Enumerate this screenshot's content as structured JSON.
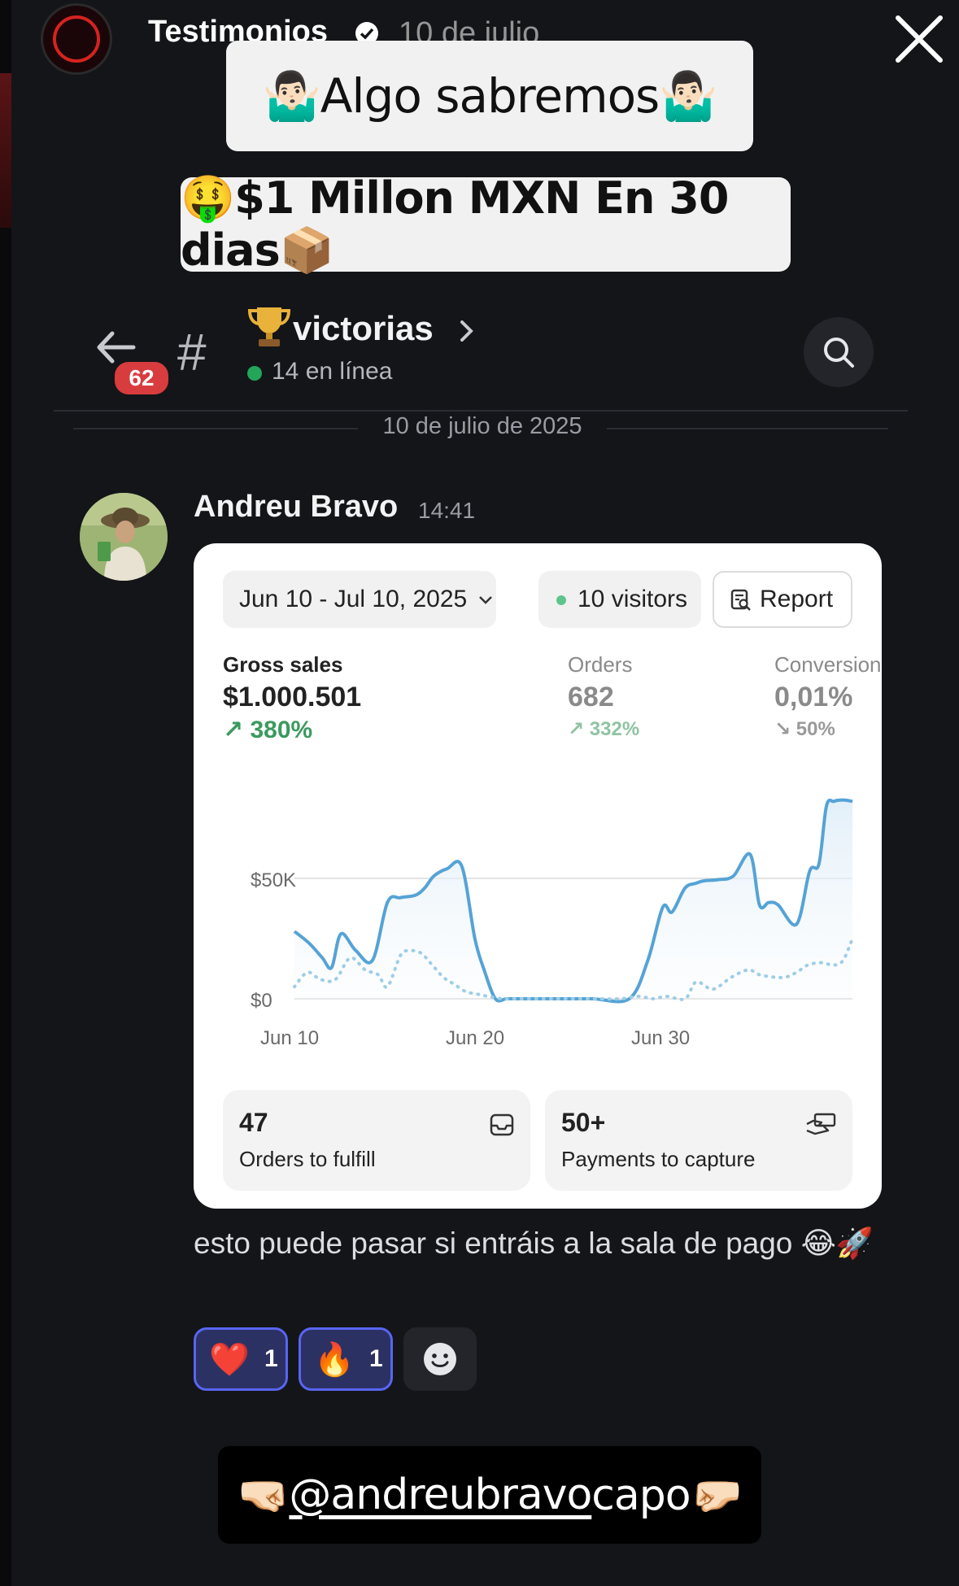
{
  "story": {
    "account": "Testimonios",
    "date": "10 de julio",
    "caption_top": "🤷🏻‍♂️Algo sabremos🤷🏻‍♂️",
    "caption_mid": "🤑$1 Millon MXN En 30 dias📦",
    "caption_bottom_prefix": "🤜🏻",
    "caption_bottom_mention": "@andreubravo",
    "caption_bottom_suffix": " capo🤛🏻"
  },
  "channel": {
    "unread_badge": "62",
    "hash": "#",
    "name": "victorias",
    "online": "14 en línea",
    "date_separator": "10 de julio de 2025"
  },
  "message": {
    "author": "Andreu Bravo",
    "time": "14:41",
    "text": "esto puede pasar si entráis a la sala de pago 😂🚀",
    "reactions": [
      {
        "emoji": "❤️",
        "count": "1"
      },
      {
        "emoji": "🔥",
        "count": "1"
      }
    ]
  },
  "shopify": {
    "date_range": "Jun 10 - Jul 10, 2025",
    "visitors": "10 visitors",
    "report": "Report",
    "metrics": [
      {
        "label": "Gross sales",
        "value": "$1.000.501",
        "delta": "380%"
      },
      {
        "label": "Orders",
        "value": "682",
        "delta": "332%"
      },
      {
        "label": "Conversion",
        "value": "0,01%",
        "delta": "50%"
      }
    ],
    "tasks": [
      {
        "value": "47",
        "label": "Orders to fulfill"
      },
      {
        "value": "50+",
        "label": "Payments to capture"
      }
    ]
  },
  "chart_data": {
    "type": "line",
    "x_tick_labels": [
      "Jun 10",
      "Jun 20",
      "Jun 30"
    ],
    "y_tick_labels": [
      "$0",
      "$50K"
    ],
    "ylim": [
      0,
      85000
    ],
    "x_day_range": [
      10,
      40
    ],
    "series": [
      {
        "style": "solid",
        "color": "#55a3d6",
        "x": [
          10,
          10.8,
          11.5,
          12,
          12.5,
          13.3,
          14.2,
          15,
          15.7,
          16.5,
          17,
          17.5,
          18.2,
          19,
          19.7,
          20.2,
          20.8,
          21.4,
          22,
          22.8,
          24,
          26,
          28,
          29,
          29.8,
          30.3,
          31,
          31.6,
          32,
          32.8,
          33.6,
          34.5,
          35,
          35.5,
          36,
          37,
          37.7,
          38.2,
          38.6,
          39,
          39.3,
          39.6,
          40
        ],
        "y": [
          28000,
          23000,
          17000,
          13000,
          27000,
          20000,
          16000,
          40000,
          42000,
          43000,
          46000,
          51000,
          54000,
          55000,
          25000,
          12000,
          0,
          0,
          0,
          0,
          0,
          0,
          0,
          16000,
          38000,
          36000,
          46000,
          48000,
          49000,
          49500,
          51000,
          60000,
          39000,
          40000,
          39000,
          31000,
          53000,
          56000,
          80000,
          82000,
          82500,
          82500,
          82000
        ]
      },
      {
        "style": "dotted",
        "color": "#9fcde6",
        "x": [
          10,
          10.7,
          11.4,
          12.2,
          13,
          13.8,
          14.5,
          15,
          15.7,
          16.2,
          16.8,
          17.3,
          18,
          18.6,
          19.2,
          19.8,
          20.4,
          21.2,
          22,
          24,
          26,
          27.5,
          28.5,
          29.3,
          30,
          31,
          31.6,
          32.5,
          33.5,
          34.4,
          35,
          35.8,
          36.4,
          37,
          37.6,
          38.3,
          39,
          39.5,
          40
        ],
        "y": [
          5000,
          11000,
          8000,
          8000,
          17000,
          12000,
          10000,
          5000,
          18000,
          20000,
          19000,
          15000,
          9000,
          6000,
          3000,
          2000,
          1000,
          0,
          0,
          0,
          0,
          0,
          1000,
          0,
          1000,
          0,
          7000,
          4000,
          9000,
          12000,
          10000,
          9000,
          9000,
          11000,
          14000,
          15000,
          14000,
          16000,
          25000
        ]
      }
    ]
  }
}
